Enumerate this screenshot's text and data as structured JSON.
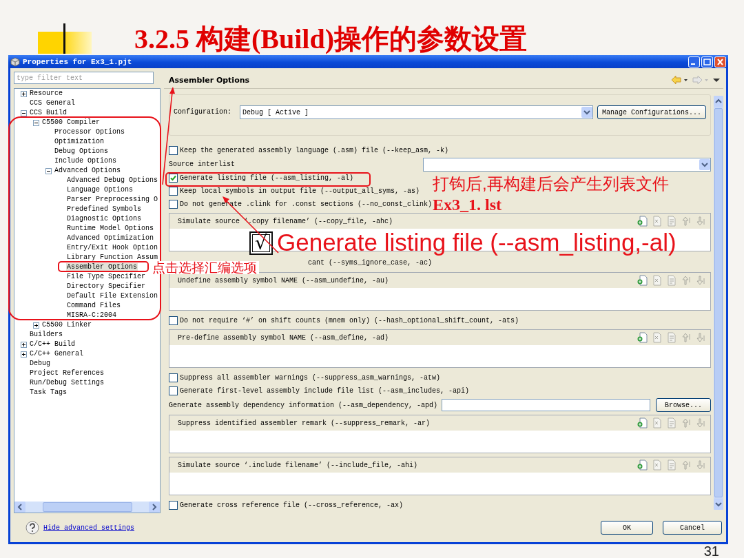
{
  "slide": {
    "title": "3.2.5 构建(Build)操作的参数设置",
    "page_number": "31"
  },
  "window": {
    "title": "Properties for Ex3_1.pjt"
  },
  "filter": {
    "placeholder": "type filter text"
  },
  "tree": [
    {
      "label": "Resource",
      "expanded": false,
      "selected": false
    },
    {
      "label": "CCS General",
      "selected": false
    },
    {
      "label": "CCS Build",
      "expanded": true,
      "selected": false,
      "children": [
        {
          "label": "C5500 Compiler",
          "expanded": true,
          "selected": false,
          "children": [
            {
              "label": "Processor Options",
              "selected": false
            },
            {
              "label": "Optimization",
              "selected": false
            },
            {
              "label": "Debug Options",
              "selected": false
            },
            {
              "label": "Include Options",
              "selected": false
            },
            {
              "label": "Advanced Options",
              "expanded": true,
              "selected": false,
              "children": [
                {
                  "label": "Advanced Debug Options",
                  "selected": false
                },
                {
                  "label": "Language Options",
                  "selected": false
                },
                {
                  "label": "Parser Preprocessing O",
                  "selected": false
                },
                {
                  "label": "Predefined Symbols",
                  "selected": false
                },
                {
                  "label": "Diagnostic Options",
                  "selected": false
                },
                {
                  "label": "Runtime Model Options",
                  "selected": false
                },
                {
                  "label": "Advanced Optimization",
                  "selected": false
                },
                {
                  "label": "Entry/Exit Hook Option",
                  "selected": false
                },
                {
                  "label": "Library Function Assum",
                  "selected": false
                },
                {
                  "label": "Assembler Options",
                  "selected": true
                },
                {
                  "label": "File Type Specifier",
                  "selected": false
                },
                {
                  "label": "Directory Specifier",
                  "selected": false
                },
                {
                  "label": "Default File Extension",
                  "selected": false
                },
                {
                  "label": "Command Files",
                  "selected": false
                },
                {
                  "label": "MISRA-C:2004",
                  "selected": false
                }
              ]
            }
          ]
        },
        {
          "label": "C5500 Linker",
          "expanded": false,
          "selected": false
        }
      ]
    },
    {
      "label": "Builders",
      "selected": false
    },
    {
      "label": "C/C++ Build",
      "expanded": false,
      "selected": false
    },
    {
      "label": "C/C++ General",
      "expanded": false,
      "selected": false
    },
    {
      "label": "Debug",
      "selected": false
    },
    {
      "label": "Project References",
      "selected": false
    },
    {
      "label": "Run/Debug Settings",
      "selected": false
    },
    {
      "label": "Task Tags",
      "selected": false
    }
  ],
  "panel": {
    "title": "Assembler Options",
    "configuration": {
      "label": "Configuration:",
      "value": "Debug  [ Active ]"
    },
    "manage_button": "Manage Configurations...",
    "options": [
      {
        "kind": "checkbox",
        "label": "Keep the generated assembly language (.asm) file (--keep_asm, -k)",
        "checked": false
      },
      {
        "kind": "combo",
        "label": "Source interlist"
      },
      {
        "kind": "checkbox",
        "label": "Generate listing file (--asm_listing, -al)",
        "checked": true
      },
      {
        "kind": "checkbox",
        "label": "Keep local symbols in output file (--output_all_syms, -as)",
        "checked": false
      },
      {
        "kind": "checkbox",
        "label": "Do not generate .clink for .const sections (--no_const_clink)",
        "checked": false
      },
      {
        "kind": "list",
        "label": "Simulate source ‘.copy filename’ (--copy_file, -ahc)"
      },
      {
        "kind": "text",
        "label": "cant (--syms_ignore_case, -ac)"
      },
      {
        "kind": "list",
        "label": "Undefine assembly symbol NAME (--asm_undefine, -au)"
      },
      {
        "kind": "checkbox",
        "label": "Do not require ‘#’ on shift counts (mnem only) (--hash_optional_shift_count, -ats)",
        "checked": false
      },
      {
        "kind": "list",
        "label": "Pre-define assembly symbol NAME (--asm_define, -ad)"
      },
      {
        "kind": "checkbox",
        "label": "Suppress all assembler warnings (--suppress_asm_warnings, -atw)",
        "checked": false
      },
      {
        "kind": "checkbox",
        "label": "Generate first-level assembly include file list (--asm_includes, -api)",
        "checked": false
      },
      {
        "kind": "file",
        "label": "Generate assembly dependency information (--asm_dependency, -apd)",
        "button": "Browse..."
      },
      {
        "kind": "list",
        "label": "Suppress identified assembler remark (--suppress_remark, -ar)"
      },
      {
        "kind": "list",
        "label": "Simulate source ‘.include filename’ (--include_file, -ahi)"
      },
      {
        "kind": "checkbox",
        "label": "Generate cross reference file (--cross_reference, -ax)",
        "checked": false
      }
    ]
  },
  "footer": {
    "link": "Hide advanced settings",
    "buttons": [
      "OK",
      "Cancel"
    ]
  },
  "annotations": {
    "tree_note": "点击选择汇编选项",
    "result_note": [
      "打钩后,再构建后会产生列表文件",
      "Ex3_1. lst"
    ],
    "callout": {
      "mark": "√",
      "text": "Generate listing file (--asm_listing,-al)"
    }
  }
}
